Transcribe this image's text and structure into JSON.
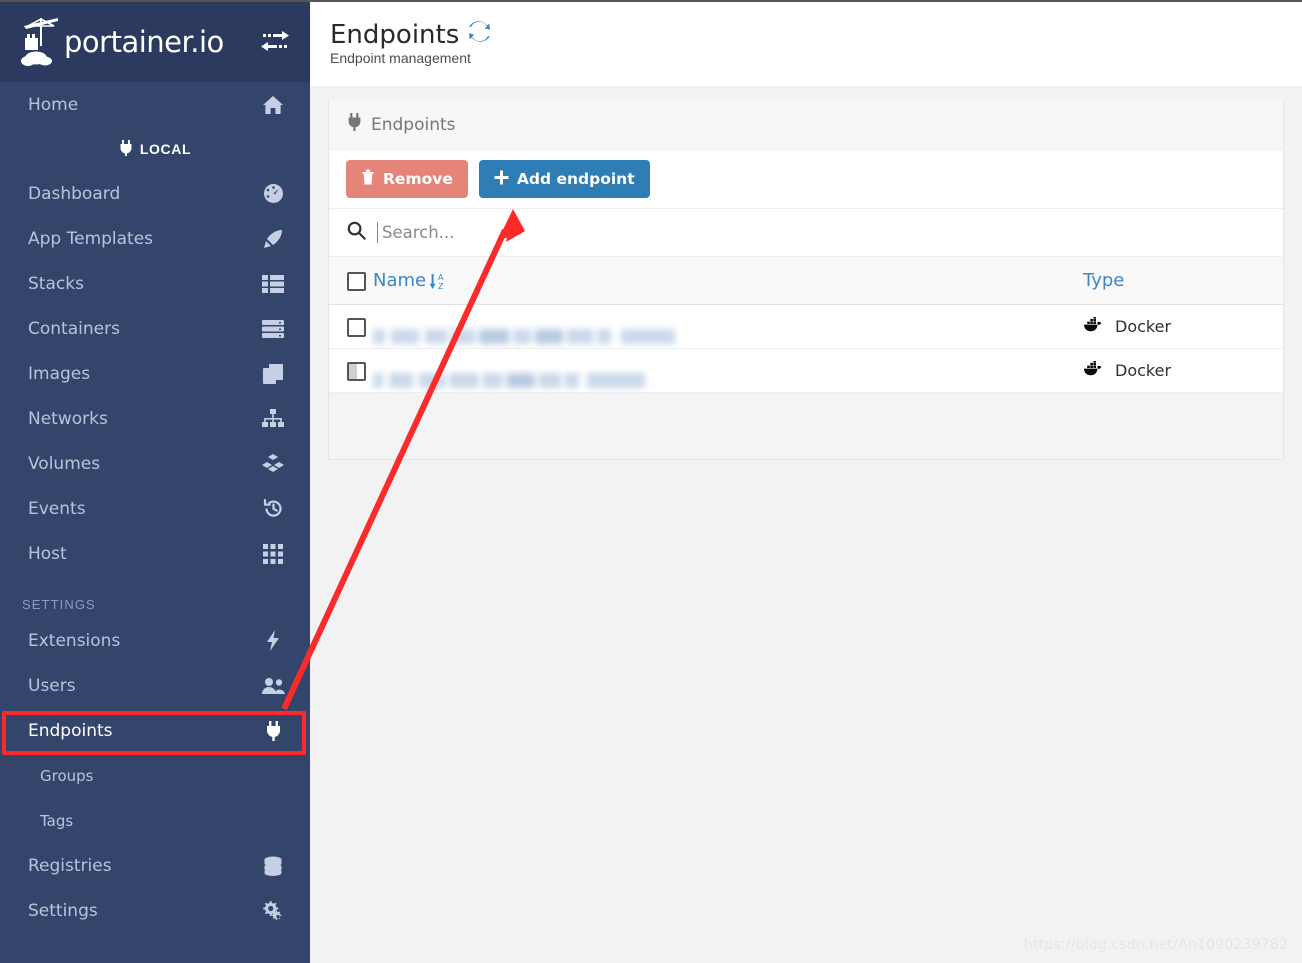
{
  "brand": {
    "name": "portainer.io",
    "logo_icon": "portainer-crane-logo",
    "toggle_icon": "exchange-arrows-icon"
  },
  "sidebar": {
    "home": {
      "label": "Home",
      "icon": "home-icon"
    },
    "local_badge": {
      "label": "LOCAL",
      "icon": "plug-icon"
    },
    "items": [
      {
        "label": "Dashboard",
        "icon": "tachometer-icon"
      },
      {
        "label": "App Templates",
        "icon": "rocket-icon"
      },
      {
        "label": "Stacks",
        "icon": "list-icon"
      },
      {
        "label": "Containers",
        "icon": "server-icon"
      },
      {
        "label": "Images",
        "icon": "clone-icon"
      },
      {
        "label": "Networks",
        "icon": "sitemap-icon"
      },
      {
        "label": "Volumes",
        "icon": "cubes-icon"
      },
      {
        "label": "Events",
        "icon": "history-icon"
      },
      {
        "label": "Host",
        "icon": "th-icon"
      }
    ],
    "section_label": "SETTINGS",
    "settings_items": [
      {
        "label": "Extensions",
        "icon": "bolt-icon"
      },
      {
        "label": "Users",
        "icon": "users-icon"
      },
      {
        "label": "Endpoints",
        "icon": "plug-icon"
      }
    ],
    "sub_items": [
      {
        "label": "Groups"
      },
      {
        "label": "Tags"
      }
    ],
    "settings_items_2": [
      {
        "label": "Registries",
        "icon": "database-icon"
      },
      {
        "label": "Settings",
        "icon": "cogs-icon"
      }
    ],
    "active_item": "Endpoints"
  },
  "header": {
    "title": "Endpoints",
    "refresh_icon": "refresh-icon",
    "subtitle": "Endpoint management"
  },
  "panel": {
    "title": "Endpoints",
    "title_icon": "plug-icon",
    "remove_button": {
      "label": "Remove",
      "icon": "trash-icon"
    },
    "add_button": {
      "label": "Add endpoint",
      "icon": "plus-icon"
    },
    "search": {
      "placeholder": "Search...",
      "value": "",
      "icon": "search-icon"
    },
    "columns": [
      {
        "label": "Name",
        "sort_icon": "sort-alpha-down-icon"
      },
      {
        "label": "Type"
      }
    ],
    "rows": [
      {
        "name": "",
        "name_redacted": true,
        "type": "Docker",
        "type_icon": "docker-icon",
        "selected": false
      },
      {
        "name": "",
        "name_redacted": true,
        "type": "Docker",
        "type_icon": "docker-icon",
        "selected": false
      }
    ]
  },
  "annotation": {
    "highlight_target": "Endpoints",
    "arrow_color": "#fc2a2a",
    "highlight_color": "#fc2a2a"
  },
  "watermark": {
    "text": "https://blog.csdn.net/An1090239782"
  },
  "colors": {
    "sidebar_bg": "#33456b",
    "sidebar_header_bg": "#2b3a5e",
    "accent_blue": "#2e7db4",
    "link_blue": "#3d86c6",
    "danger_red": "#e58579",
    "content_bg": "#f2f2f2"
  }
}
